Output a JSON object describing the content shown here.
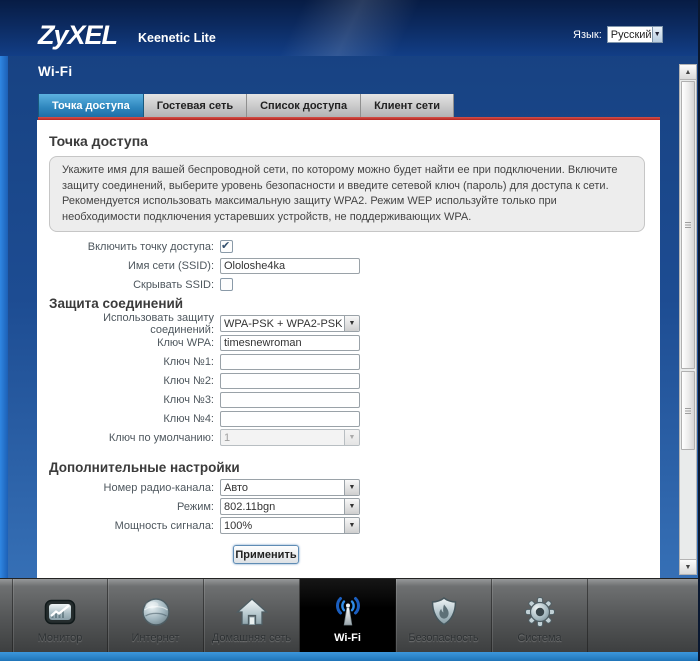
{
  "header": {
    "logo": "ZyXEL",
    "product": "Keenetic Lite",
    "language_label": "Язык:",
    "language_value": "Русский"
  },
  "page_title": "Wi-Fi",
  "tabs": [
    {
      "label": "Точка доступа",
      "active": true
    },
    {
      "label": "Гостевая сеть",
      "active": false
    },
    {
      "label": "Список доступа",
      "active": false
    },
    {
      "label": "Клиент сети",
      "active": false
    }
  ],
  "content": {
    "section_title": "Точка доступа",
    "info_text": "Укажите имя для вашей беспроводной сети, по которому можно будет найти ее при подключении. Включите защиту соединений, выберите уровень безопасности и введите сетевой ключ (пароль) для доступа к сети. Рекомендуется использовать максимальную защиту WPA2. Режим WEP используйте только при необходимости подключения устаревших устройств, не поддерживающих WPA."
  },
  "form": {
    "enable_ap_label": "Включить точку доступа:",
    "enable_ap_checked": true,
    "ssid_label": "Имя сети (SSID):",
    "ssid_value": "Ololoshe4ka",
    "hide_ssid_label": "Скрывать SSID:",
    "hide_ssid_checked": false,
    "security_section_title": "Защита соединений",
    "security_label": "Использовать защиту соединений:",
    "security_value": "WPA-PSK + WPA2-PSK",
    "wpa_key_label": "Ключ WPA:",
    "wpa_key_value": "timesnewroman",
    "key1_label": "Ключ №1:",
    "key2_label": "Ключ №2:",
    "key3_label": "Ключ №3:",
    "key4_label": "Ключ №4:",
    "default_key_label": "Ключ по умолчанию:",
    "default_key_value": "1",
    "advanced_section_title": "Дополнительные настройки",
    "channel_label": "Номер радио-канала:",
    "channel_value": "Авто",
    "mode_label": "Режим:",
    "mode_value": "802.11bgn",
    "power_label": "Мощность сигнала:",
    "power_value": "100%",
    "apply_button": "Применить"
  },
  "nav": {
    "items": [
      {
        "label": "Монитор",
        "icon": "monitor-icon",
        "active": false
      },
      {
        "label": "Интернет",
        "icon": "globe-icon",
        "active": false
      },
      {
        "label": "Домашняя сеть",
        "icon": "home-icon",
        "active": false
      },
      {
        "label": "Wi-Fi",
        "icon": "wifi-icon",
        "active": true
      },
      {
        "label": "Безопасность",
        "icon": "shield-icon",
        "active": false
      },
      {
        "label": "Система",
        "icon": "gear-icon",
        "active": false
      }
    ]
  },
  "colors": {
    "header_navy": "#0c2a60",
    "active_tab_blue": "#2e86bd",
    "accent_red_line": "#c0322e",
    "wifi_wave_blue": "#2f8de8",
    "nav_active_black": "#000000",
    "bottom_strip_blue": "#2f8ed6"
  }
}
